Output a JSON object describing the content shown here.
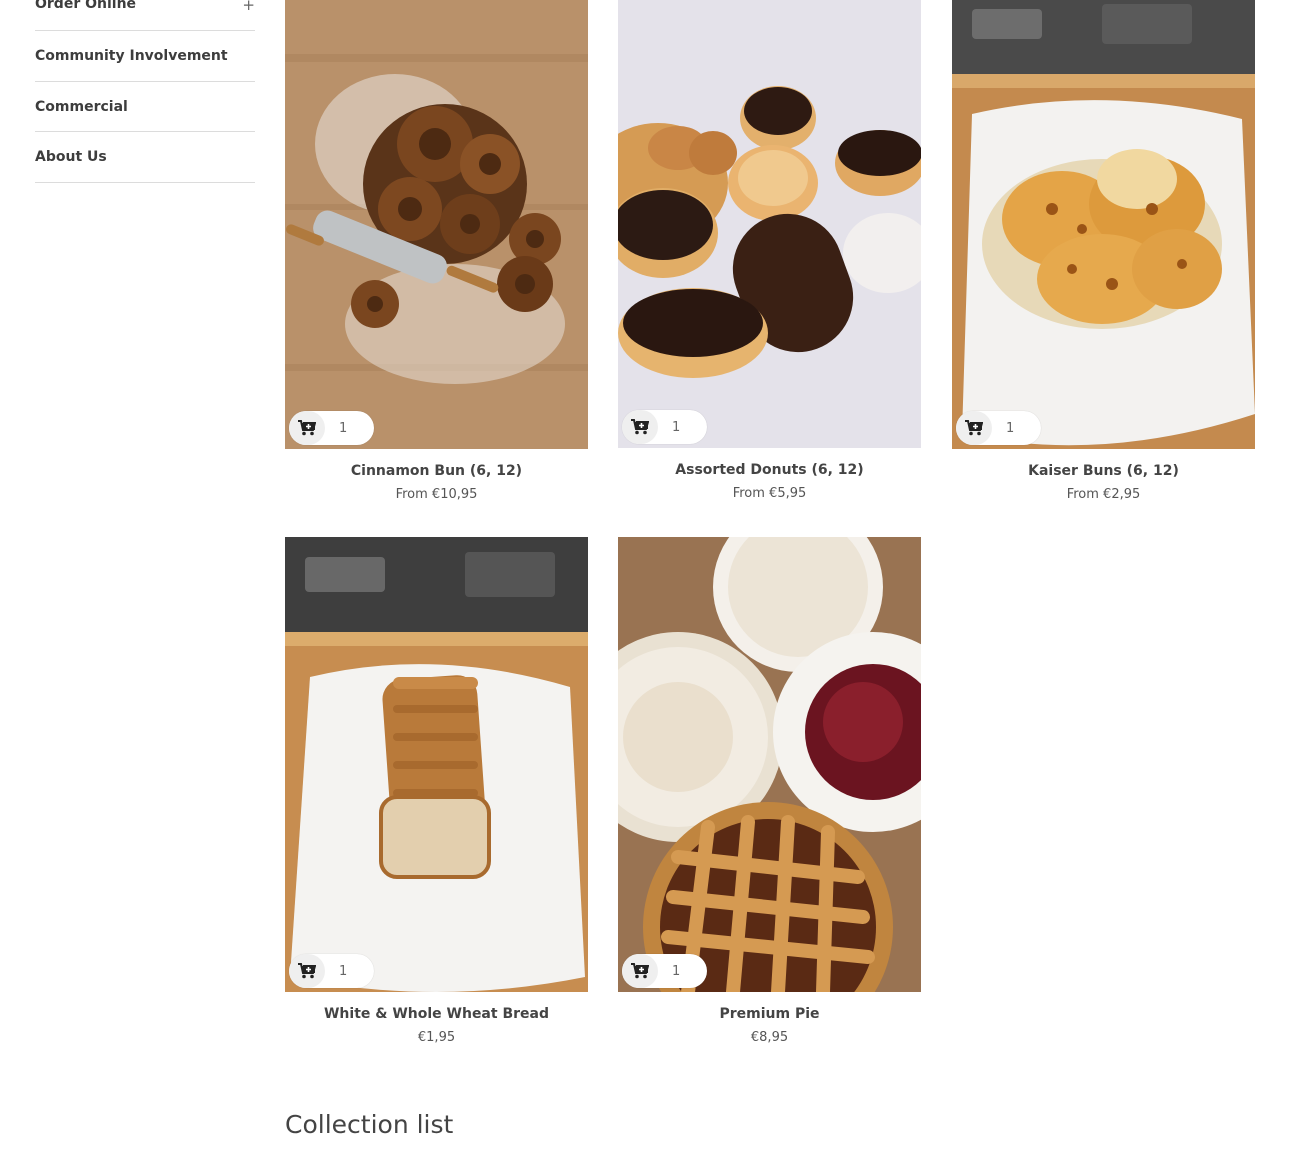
{
  "sidebar": {
    "items": [
      {
        "label": "Order Online",
        "expand": "+"
      },
      {
        "label": "Community Involvement"
      },
      {
        "label": "Commercial"
      },
      {
        "label": "About Us"
      }
    ]
  },
  "products": [
    {
      "title": "Cinnamon Bun (6, 12)",
      "price": "From €10,95",
      "qty": "1"
    },
    {
      "title": "Assorted Donuts (6, 12)",
      "price": "From €5,95",
      "qty": "1"
    },
    {
      "title": "Kaiser Buns (6, 12)",
      "price": "From €2,95",
      "qty": "1"
    },
    {
      "title": "White & Whole Wheat Bread",
      "price": "€1,95",
      "qty": "1"
    },
    {
      "title": "Premium Pie",
      "price": "€8,95",
      "qty": "1"
    }
  ],
  "collection": {
    "heading": "Collection list"
  }
}
